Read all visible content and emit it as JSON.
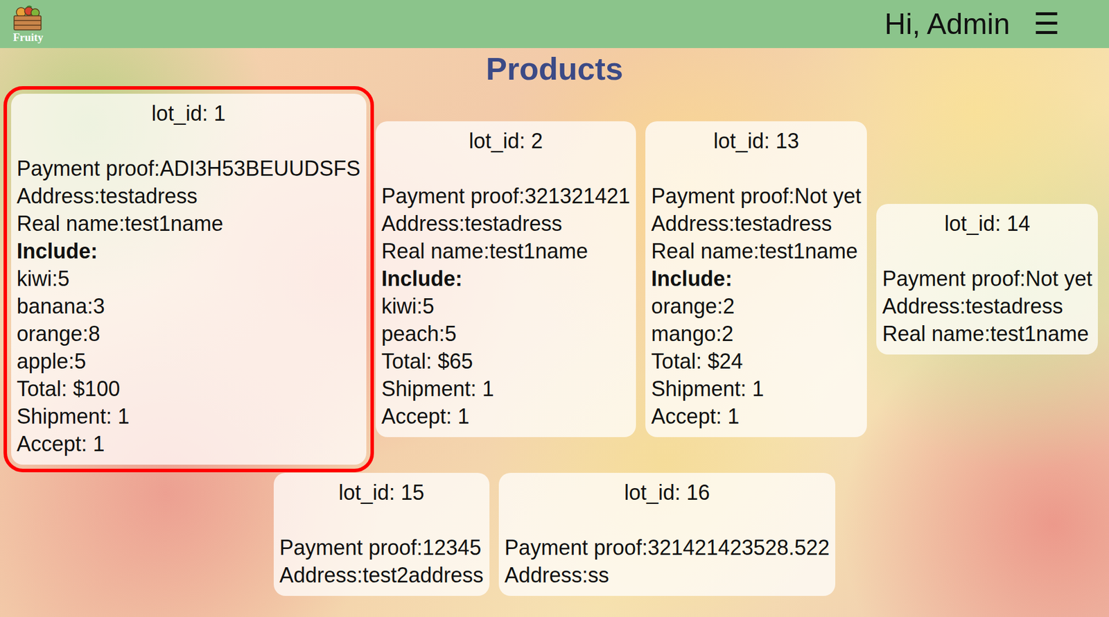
{
  "header": {
    "logo_text": "Fruity",
    "greeting": "Hi, Admin",
    "menu_icon": "☰"
  },
  "title": "Products",
  "lots": [
    {
      "lot_id": "lot_id: 1",
      "fields": [
        "Payment proof:ADI3H53BEUUDSFS",
        "Address:testadress",
        "Real name:test1name"
      ],
      "include_label": "Include:",
      "items": [
        "kiwi:5",
        "banana:3",
        "orange:8",
        "apple:5"
      ],
      "summary": [
        "Total: $100",
        "Shipment: 1",
        "Accept: 1"
      ],
      "highlighted": true
    },
    {
      "lot_id": "lot_id: 2",
      "fields": [
        "Payment proof:321321421",
        "Address:testadress",
        "Real name:test1name"
      ],
      "include_label": "Include:",
      "items": [
        "kiwi:5",
        "peach:5"
      ],
      "summary": [
        "Total: $65",
        "Shipment: 1",
        "Accept: 1"
      ],
      "highlighted": false
    },
    {
      "lot_id": "lot_id: 13",
      "fields": [
        "Payment proof:Not yet",
        "Address:testadress",
        "Real name:test1name"
      ],
      "include_label": "Include:",
      "items": [
        "orange:2",
        "mango:2"
      ],
      "summary": [
        "Total: $24",
        "Shipment: 1",
        "Accept: 1"
      ],
      "highlighted": false
    },
    {
      "lot_id": "lot_id: 14",
      "fields": [
        "Payment proof:Not yet",
        "Address:testadress",
        "Real name:test1name"
      ],
      "items": [],
      "summary": [],
      "highlighted": false
    },
    {
      "lot_id": "lot_id: 15",
      "fields": [
        "Payment proof:12345",
        "Address:test2address"
      ],
      "items": [],
      "summary": [],
      "highlighted": false
    },
    {
      "lot_id": "lot_id: 16",
      "fields": [
        "Payment proof:321421423528.522",
        "Address:ss"
      ],
      "items": [],
      "summary": [],
      "highlighted": false
    }
  ]
}
